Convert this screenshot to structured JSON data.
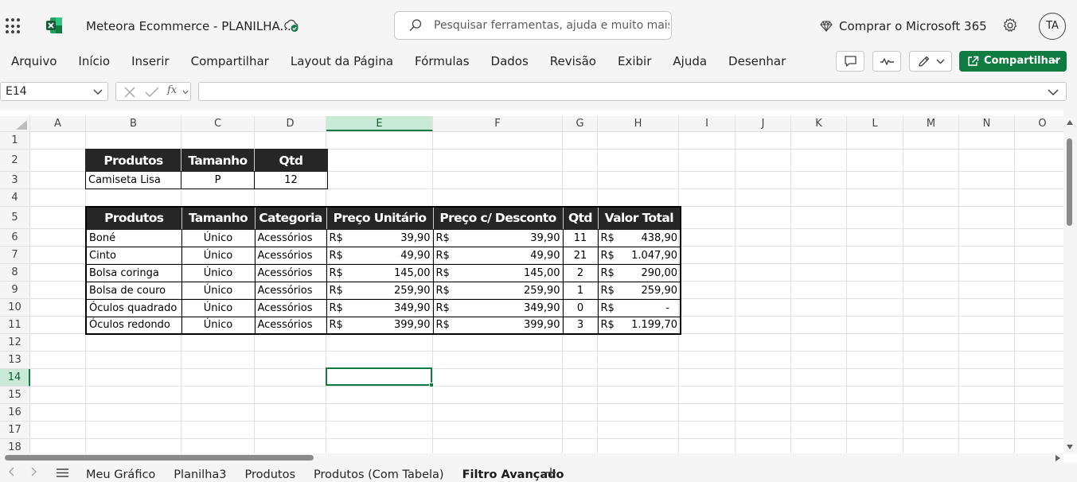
{
  "title_bar": {
    "doc_title": "Meteora Ecommerce - PLANILHA...",
    "search_placeholder": "Pesquisar ferramentas, ajuda e muito mais (Alt + Q)",
    "buy_label": "Comprar o Microsoft 365",
    "user_initials": "TA"
  },
  "ribbon": {
    "tabs": [
      "Arquivo",
      "Início",
      "Inserir",
      "Compartilhar",
      "Layout da Página",
      "Fórmulas",
      "Dados",
      "Revisão",
      "Exibir",
      "Ajuda",
      "Desenhar"
    ],
    "share_label": "Compartilhar"
  },
  "formula_bar": {
    "name_box": "E14",
    "fx_label": "fx",
    "formula": ""
  },
  "grid": {
    "columns": [
      "A",
      "B",
      "C",
      "D",
      "E",
      "F",
      "G",
      "H",
      "I",
      "J",
      "K",
      "L",
      "M",
      "N",
      "O"
    ],
    "rows": [
      "1",
      "2",
      "3",
      "4",
      "5",
      "6",
      "7",
      "8",
      "9",
      "10",
      "11",
      "12",
      "13",
      "14",
      "15",
      "16",
      "17",
      "18"
    ],
    "selected_column": "E",
    "selected_row": "14"
  },
  "criteria_table": {
    "headers": [
      "Produtos",
      "Tamanho",
      "Qtd"
    ],
    "row": [
      "Camiseta Lisa",
      "P",
      "12"
    ]
  },
  "products_table": {
    "headers": [
      "Produtos",
      "Tamanho",
      "Categoria",
      "Preço Unitário",
      "Preço c/ Desconto",
      "Qtd",
      "Valor Total"
    ],
    "currency": "R$",
    "rows": [
      [
        "Boné",
        "Único",
        "Acessórios",
        "39,90",
        "39,90",
        "11",
        "438,90"
      ],
      [
        "Cinto",
        "Único",
        "Acessórios",
        "49,90",
        "49,90",
        "21",
        "1.047,90"
      ],
      [
        "Bolsa coringa",
        "Único",
        "Acessórios",
        "145,00",
        "145,00",
        "2",
        "290,00"
      ],
      [
        "Bolsa de couro",
        "Único",
        "Acessórios",
        "259,90",
        "259,90",
        "1",
        "259,90"
      ],
      [
        "Óculos quadrado",
        "Único",
        "Acessórios",
        "349,90",
        "349,90",
        "0",
        "-"
      ],
      [
        "Óculos redondo",
        "Único",
        "Acessórios",
        "399,90",
        "399,90",
        "3",
        "1.199,70"
      ]
    ]
  },
  "sheet_tabs": {
    "tabs": [
      "Meu Gráfico",
      "Planilha3",
      "Produtos",
      "Produtos (Com Tabela)",
      "Filtro Avançado"
    ],
    "active": "Filtro Avançado"
  },
  "colors": {
    "excel_green": "#107c41",
    "header_fill": "#262626",
    "selection_fill": "#caead8"
  }
}
